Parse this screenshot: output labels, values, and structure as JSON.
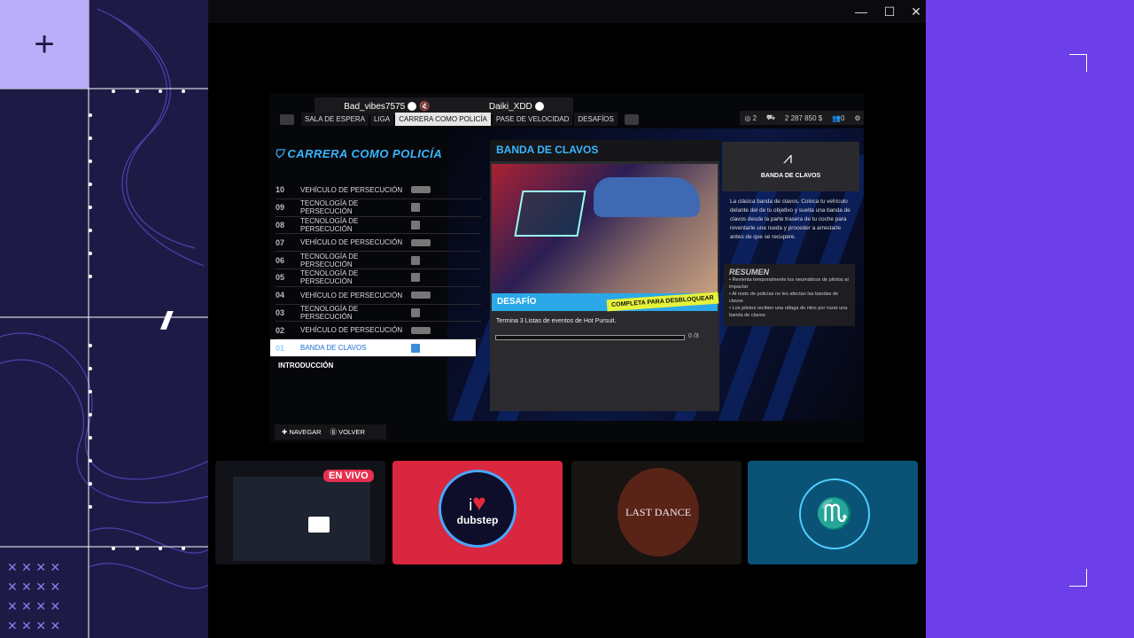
{
  "window": {
    "minimize_icon": "minimize-icon",
    "maximize_icon": "maximize-icon",
    "close_icon": "close-icon"
  },
  "players": {
    "player1": "Bad_vibes7575",
    "player2": "Daiki_XDD"
  },
  "tabs": [
    "SALA DE ESPERA",
    "LIGA",
    "CARRERA COMO POLICÍA",
    "PASE DE VELOCIDAD",
    "DESAFÍOS"
  ],
  "stats": {
    "level": "2",
    "money": "2 287 850 $",
    "friends": "0"
  },
  "career": {
    "title": "CARRERA COMO POLICÍA",
    "rows": [
      {
        "num": "10",
        "label": "VEHÍCULO DE PERSECUCIÓN",
        "icon": "car-icon"
      },
      {
        "num": "09",
        "label": "TECNOLOGÍA DE PERSECUCIÓN",
        "icon": "cube-icon"
      },
      {
        "num": "08",
        "label": "TECNOLOGÍA DE PERSECUCIÓN",
        "icon": "cube-icon"
      },
      {
        "num": "07",
        "label": "VEHÍCULO DE PERSECUCIÓN",
        "icon": "car-icon"
      },
      {
        "num": "06",
        "label": "TECNOLOGÍA DE PERSECUCIÓN",
        "icon": "cube-icon"
      },
      {
        "num": "05",
        "label": "TECNOLOGÍA DE PERSECUCIÓN",
        "icon": "cube-icon"
      },
      {
        "num": "04",
        "label": "VEHÍCULO DE PERSECUCIÓN",
        "icon": "car-icon"
      },
      {
        "num": "03",
        "label": "TECNOLOGÍA DE PERSECUCIÓN",
        "icon": "cube-icon"
      },
      {
        "num": "02",
        "label": "VEHÍCULO DE PERSECUCIÓN",
        "icon": "car-icon"
      },
      {
        "num": "01",
        "label": "BANDA DE CLAVOS",
        "icon": "cube-icon"
      }
    ],
    "intro": "INTRODUCCIÓN"
  },
  "detail": {
    "title": "BANDA DE CLAVOS",
    "challenge_label": "DESAFÍO",
    "unlock_tag": "COMPLETA PARA DESBLOQUEAR",
    "task": "Termina 3 Listas de eventos de Hot Pursuit.",
    "progress_value": 0,
    "progress_text": "0 /3"
  },
  "side": {
    "card_title": "BANDA DE CLAVOS",
    "description": "La clásica banda de clavos. Coloca tu vehículo delante del de tu objetivo y suelta una banda de clavos desde la parte trasera de tu coche para reventarle una rueda y proceder a arrestarle antes de que se recupere.",
    "summary_title": "RESUMEN",
    "summary_items": [
      "• Revienta temporalmente los neumáticos de pilotos al impactar",
      "• Al resto de policías no les afectan las bandas de clavos",
      "• Los pilotos reciben una ráfaga de nitro por rozar una banda de clavos"
    ]
  },
  "footer": {
    "navigate": "NAVEGAR",
    "back": "VOLVER"
  },
  "streams": {
    "live_badge": "EN VIVO",
    "dubstep_prefix": "i",
    "dubstep_text": "dubstep",
    "last_dance": "LAST DANCE"
  }
}
